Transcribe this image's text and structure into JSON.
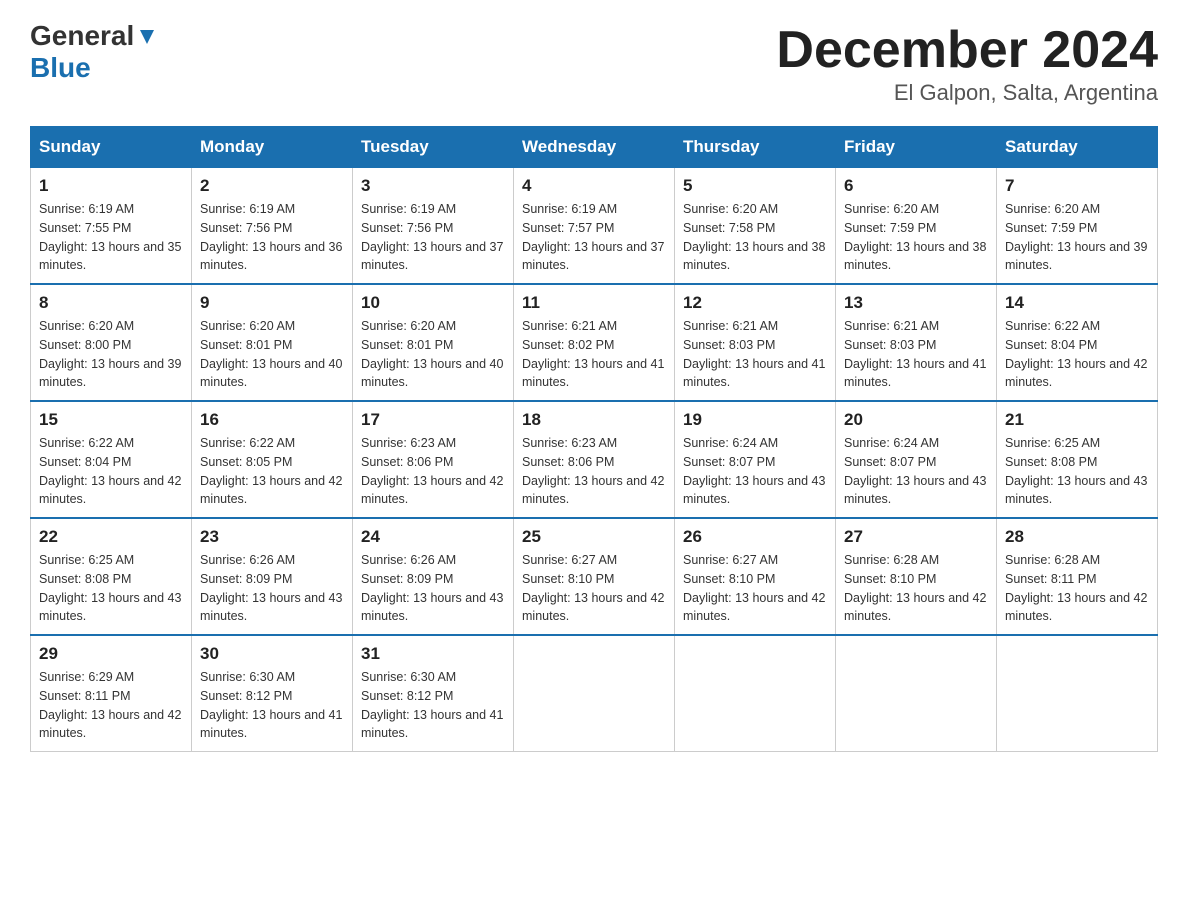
{
  "header": {
    "logo_general": "General",
    "logo_blue": "Blue",
    "month_title": "December 2024",
    "location": "El Galpon, Salta, Argentina"
  },
  "weekdays": [
    "Sunday",
    "Monday",
    "Tuesday",
    "Wednesday",
    "Thursday",
    "Friday",
    "Saturday"
  ],
  "weeks": [
    [
      {
        "day": "1",
        "sunrise": "6:19 AM",
        "sunset": "7:55 PM",
        "daylight": "13 hours and 35 minutes."
      },
      {
        "day": "2",
        "sunrise": "6:19 AM",
        "sunset": "7:56 PM",
        "daylight": "13 hours and 36 minutes."
      },
      {
        "day": "3",
        "sunrise": "6:19 AM",
        "sunset": "7:56 PM",
        "daylight": "13 hours and 37 minutes."
      },
      {
        "day": "4",
        "sunrise": "6:19 AM",
        "sunset": "7:57 PM",
        "daylight": "13 hours and 37 minutes."
      },
      {
        "day": "5",
        "sunrise": "6:20 AM",
        "sunset": "7:58 PM",
        "daylight": "13 hours and 38 minutes."
      },
      {
        "day": "6",
        "sunrise": "6:20 AM",
        "sunset": "7:59 PM",
        "daylight": "13 hours and 38 minutes."
      },
      {
        "day": "7",
        "sunrise": "6:20 AM",
        "sunset": "7:59 PM",
        "daylight": "13 hours and 39 minutes."
      }
    ],
    [
      {
        "day": "8",
        "sunrise": "6:20 AM",
        "sunset": "8:00 PM",
        "daylight": "13 hours and 39 minutes."
      },
      {
        "day": "9",
        "sunrise": "6:20 AM",
        "sunset": "8:01 PM",
        "daylight": "13 hours and 40 minutes."
      },
      {
        "day": "10",
        "sunrise": "6:20 AM",
        "sunset": "8:01 PM",
        "daylight": "13 hours and 40 minutes."
      },
      {
        "day": "11",
        "sunrise": "6:21 AM",
        "sunset": "8:02 PM",
        "daylight": "13 hours and 41 minutes."
      },
      {
        "day": "12",
        "sunrise": "6:21 AM",
        "sunset": "8:03 PM",
        "daylight": "13 hours and 41 minutes."
      },
      {
        "day": "13",
        "sunrise": "6:21 AM",
        "sunset": "8:03 PM",
        "daylight": "13 hours and 41 minutes."
      },
      {
        "day": "14",
        "sunrise": "6:22 AM",
        "sunset": "8:04 PM",
        "daylight": "13 hours and 42 minutes."
      }
    ],
    [
      {
        "day": "15",
        "sunrise": "6:22 AM",
        "sunset": "8:04 PM",
        "daylight": "13 hours and 42 minutes."
      },
      {
        "day": "16",
        "sunrise": "6:22 AM",
        "sunset": "8:05 PM",
        "daylight": "13 hours and 42 minutes."
      },
      {
        "day": "17",
        "sunrise": "6:23 AM",
        "sunset": "8:06 PM",
        "daylight": "13 hours and 42 minutes."
      },
      {
        "day": "18",
        "sunrise": "6:23 AM",
        "sunset": "8:06 PM",
        "daylight": "13 hours and 42 minutes."
      },
      {
        "day": "19",
        "sunrise": "6:24 AM",
        "sunset": "8:07 PM",
        "daylight": "13 hours and 43 minutes."
      },
      {
        "day": "20",
        "sunrise": "6:24 AM",
        "sunset": "8:07 PM",
        "daylight": "13 hours and 43 minutes."
      },
      {
        "day": "21",
        "sunrise": "6:25 AM",
        "sunset": "8:08 PM",
        "daylight": "13 hours and 43 minutes."
      }
    ],
    [
      {
        "day": "22",
        "sunrise": "6:25 AM",
        "sunset": "8:08 PM",
        "daylight": "13 hours and 43 minutes."
      },
      {
        "day": "23",
        "sunrise": "6:26 AM",
        "sunset": "8:09 PM",
        "daylight": "13 hours and 43 minutes."
      },
      {
        "day": "24",
        "sunrise": "6:26 AM",
        "sunset": "8:09 PM",
        "daylight": "13 hours and 43 minutes."
      },
      {
        "day": "25",
        "sunrise": "6:27 AM",
        "sunset": "8:10 PM",
        "daylight": "13 hours and 42 minutes."
      },
      {
        "day": "26",
        "sunrise": "6:27 AM",
        "sunset": "8:10 PM",
        "daylight": "13 hours and 42 minutes."
      },
      {
        "day": "27",
        "sunrise": "6:28 AM",
        "sunset": "8:10 PM",
        "daylight": "13 hours and 42 minutes."
      },
      {
        "day": "28",
        "sunrise": "6:28 AM",
        "sunset": "8:11 PM",
        "daylight": "13 hours and 42 minutes."
      }
    ],
    [
      {
        "day": "29",
        "sunrise": "6:29 AM",
        "sunset": "8:11 PM",
        "daylight": "13 hours and 42 minutes."
      },
      {
        "day": "30",
        "sunrise": "6:30 AM",
        "sunset": "8:12 PM",
        "daylight": "13 hours and 41 minutes."
      },
      {
        "day": "31",
        "sunrise": "6:30 AM",
        "sunset": "8:12 PM",
        "daylight": "13 hours and 41 minutes."
      },
      null,
      null,
      null,
      null
    ]
  ]
}
